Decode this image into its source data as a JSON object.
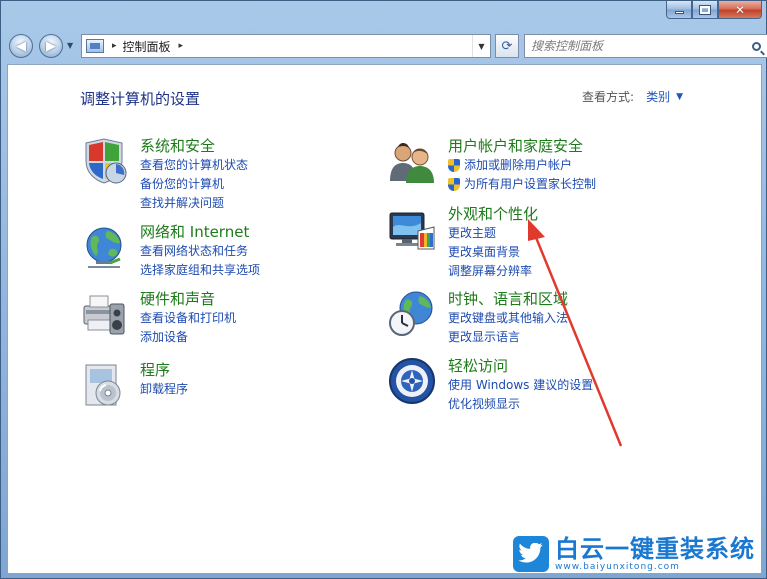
{
  "window": {
    "minimize_glyph": "",
    "maximize_glyph": "",
    "close_glyph": "✕"
  },
  "address_bar": {
    "path": "控制面板",
    "separator": "▸",
    "back_glyph": "◀",
    "forward_glyph": "▶",
    "refresh_glyph": "⟳"
  },
  "search": {
    "placeholder": "搜索控制面板"
  },
  "header": {
    "title": "调整计算机的设置",
    "view_label": "查看方式:",
    "view_value": "类别"
  },
  "categories": [
    {
      "title": "系统和安全",
      "icon": "system-security-icon",
      "links": [
        "查看您的计算机状态",
        "备份您的计算机",
        "查找并解决问题"
      ]
    },
    {
      "title": "网络和 Internet",
      "icon": "network-internet-icon",
      "links": [
        "查看网络状态和任务",
        "选择家庭组和共享选项"
      ]
    },
    {
      "title": "硬件和声音",
      "icon": "hardware-sound-icon",
      "links": [
        "查看设备和打印机",
        "添加设备"
      ]
    },
    {
      "title": "程序",
      "icon": "programs-icon",
      "links": [
        "卸载程序"
      ]
    },
    {
      "title": "用户帐户和家庭安全",
      "icon": "user-accounts-icon",
      "links": [
        "添加或删除用户帐户",
        "为所有用户设置家长控制"
      ]
    },
    {
      "title": "外观和个性化",
      "icon": "appearance-icon",
      "links": [
        "更改主题",
        "更改桌面背景",
        "调整屏幕分辨率"
      ]
    },
    {
      "title": "时钟、语言和区域",
      "icon": "clock-language-icon",
      "links": [
        "更改键盘或其他输入法",
        "更改显示语言"
      ]
    },
    {
      "title": "轻松访问",
      "icon": "ease-of-access-icon",
      "links": [
        "使用 Windows 建议的设置",
        "优化视频显示"
      ]
    }
  ],
  "watermark": {
    "main": "白云一键重装系统",
    "sub": "www.baiyunxitong.com"
  },
  "colors": {
    "link": "#1e4bb0",
    "category_title": "#1e7b1a",
    "page_title": "#1e3287",
    "annotation_arrow": "#e03a2e",
    "watermark": "#1a78d0"
  }
}
